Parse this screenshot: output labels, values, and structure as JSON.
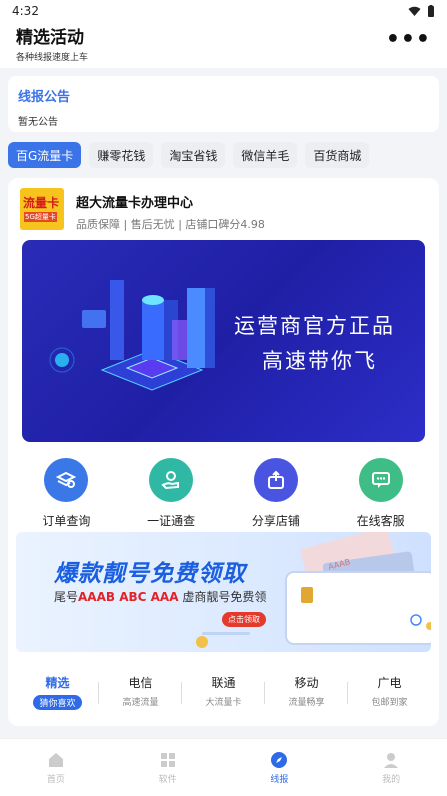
{
  "status": {
    "time": "4:32"
  },
  "header": {
    "title": "精选活动",
    "subtitle": "各种线报速度上车"
  },
  "notice": {
    "title": "线报公告",
    "text": "暂无公告"
  },
  "categories": [
    "百G流量卡",
    "赚零花钱",
    "淘宝省钱",
    "微信羊毛",
    "百货商城"
  ],
  "shop": {
    "logo_text_1": "流量卡",
    "logo_text_2": "5G超量卡",
    "name": "超大流量卡办理中心",
    "meta": "品质保障 | 售后无忧 | 店铺口碑分4.98"
  },
  "banner": {
    "line1": "运营商官方正品",
    "line2": "高速带你飞"
  },
  "quick_actions": [
    {
      "label": "订单查询",
      "icon": "layers-search-icon",
      "color": "#3a78e8"
    },
    {
      "label": "一证通查",
      "icon": "hand-card-icon",
      "color": "#2fb9a5"
    },
    {
      "label": "分享店铺",
      "icon": "share-box-icon",
      "color": "#4955e0"
    },
    {
      "label": "在线客服",
      "icon": "chat-bubble-icon",
      "color": "#3ebd86"
    }
  ],
  "promo": {
    "title": "爆款靓号免费领取",
    "sub_prefix": "尾号",
    "sub_codes": "AAAB  ABC  AAA",
    "sub_suffix": "虚商靓号免费领",
    "button": "点击领取",
    "card_text_1": "AAAB",
    "card_text_2": "ABC",
    "card_text_3": "AAA"
  },
  "operator_tabs": [
    {
      "name": "精选",
      "sub": "猜你喜欢",
      "active": true
    },
    {
      "name": "电信",
      "sub": "高速流量"
    },
    {
      "name": "联通",
      "sub": "大流量卡"
    },
    {
      "name": "移动",
      "sub": "流量畅享"
    },
    {
      "name": "广电",
      "sub": "包邮到家"
    }
  ],
  "bottom_nav": [
    {
      "label": "首页",
      "icon": "home-icon"
    },
    {
      "label": "软件",
      "icon": "grid-icon"
    },
    {
      "label": "线报",
      "icon": "compass-icon",
      "active": true
    },
    {
      "label": "我的",
      "icon": "user-icon"
    }
  ]
}
